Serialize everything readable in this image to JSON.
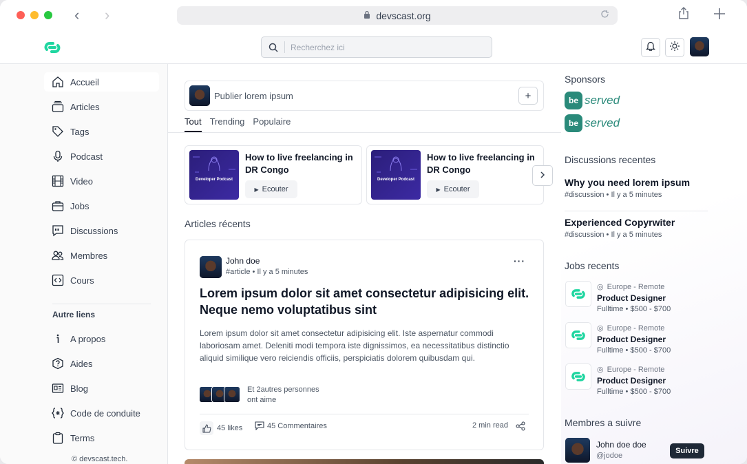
{
  "browser": {
    "url": "devscast.org"
  },
  "header": {
    "search_placeholder": "Recherchez ici"
  },
  "sidebar": {
    "items": [
      {
        "label": "Accueil",
        "icon": "home-icon"
      },
      {
        "label": "Articles",
        "icon": "articles-icon"
      },
      {
        "label": "Tags",
        "icon": "tag-icon"
      },
      {
        "label": "Podcast",
        "icon": "microphone-icon"
      },
      {
        "label": "Video",
        "icon": "film-icon"
      },
      {
        "label": "Jobs",
        "icon": "briefcase-icon"
      },
      {
        "label": "Discussions",
        "icon": "quote-icon"
      },
      {
        "label": "Membres",
        "icon": "users-icon"
      },
      {
        "label": "Cours",
        "icon": "code-icon"
      }
    ],
    "other_title": "Autre liens",
    "other_items": [
      {
        "label": "A propos",
        "icon": "info-icon"
      },
      {
        "label": "Aides",
        "icon": "help-icon"
      },
      {
        "label": "Blog",
        "icon": "newspaper-icon"
      },
      {
        "label": "Code de conduite",
        "icon": "braces-icon"
      },
      {
        "label": "Terms",
        "icon": "clipboard-icon"
      }
    ],
    "copyright": "© devscast.tech."
  },
  "main": {
    "composer_placeholder": "Publier lorem ipsum",
    "composer_add": "+",
    "tabs": [
      "Tout",
      "Trending",
      "Populaire"
    ],
    "podcasts": [
      {
        "title": "How to live freelancing in DR Congo",
        "listen": "Ecouter",
        "cover_text": "Developer Podcast"
      },
      {
        "title": "How to live freelancing in DR Congo",
        "listen": "Ecouter",
        "cover_text": "Developer Podcast"
      }
    ],
    "recent_title": "Articles récents",
    "article": {
      "author": "John doe",
      "meta": "#article • Il y a 5 minutes",
      "more": "···",
      "title": "Lorem ipsum dolor sit amet consectetur adipisicing elit. Neque nemo voluptatibus sint",
      "body": "Lorem ipsum dolor sit amet consectetur adipisicing elit. Iste aspernatur commodi laboriosam amet. Deleniti modi tempora iste dignissimos, ea necessitatibus distinctio aliquid similique vero reiciendis officiis, perspiciatis dolorem quibusdam qui.",
      "likers_text": "Et 2autres personnes ont aime",
      "likes": "45 likes",
      "comments": "45 Commentaires",
      "read_time": "2 min read"
    }
  },
  "right": {
    "sponsors_title": "Sponsors",
    "sponsor_logo": {
      "mark": "be",
      "word": "served"
    },
    "discussions_title": "Discussions recentes",
    "discussions": [
      {
        "title": "Why you need lorem ipsum",
        "meta": "#discussion • Il y a 5 minutes"
      },
      {
        "title": "Experienced Copyrwiter",
        "meta": "#discussion • Il y a 5 minutes"
      }
    ],
    "jobs_title": "Jobs recents",
    "jobs": [
      {
        "location": "Europe - Remote",
        "title": "Product Designer",
        "meta": "Fulltime • $500 - $700"
      },
      {
        "location": "Europe - Remote",
        "title": "Product Designer",
        "meta": "Fulltime • $500 - $700"
      },
      {
        "location": "Europe - Remote",
        "title": "Product Designer",
        "meta": "Fulltime • $500 - $700"
      }
    ],
    "members_title": "Membres a suivre",
    "member": {
      "name": "John doe doe",
      "handle": "@jodoe",
      "follow": "Suivre"
    }
  },
  "colors": {
    "brand": "#1fd6a0",
    "dark": "#1f2937"
  }
}
